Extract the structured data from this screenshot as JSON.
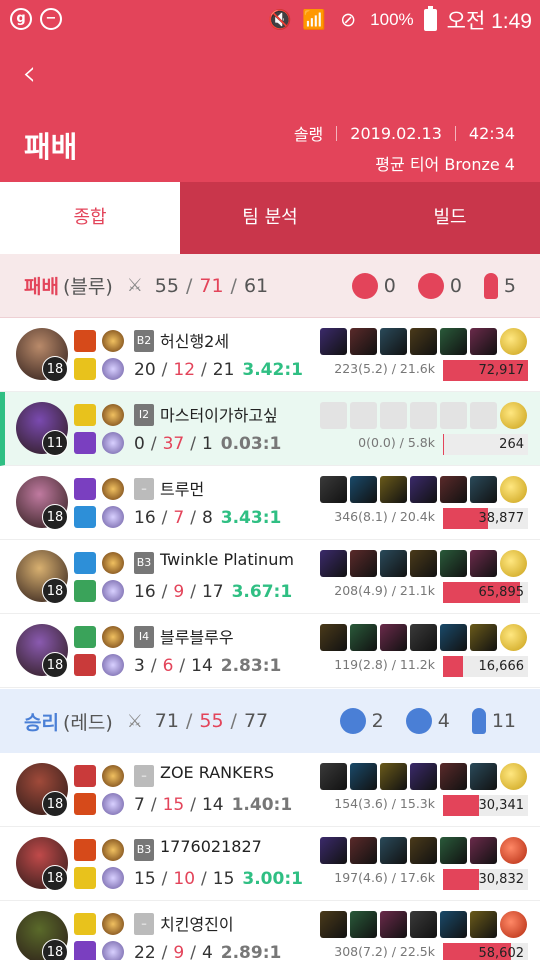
{
  "status_bar": {
    "left_icons": [
      "g",
      "−"
    ],
    "battery": "100%",
    "time": "오전 1:49"
  },
  "header": {
    "title": "패배",
    "queue": "솔랭",
    "date": "2019.02.13",
    "duration": "42:34",
    "avg_tier": "평균 티어 Bronze 4"
  },
  "tabs": [
    "종합",
    "팀 분석",
    "빌드"
  ],
  "teams": [
    {
      "result": "패배",
      "side": "(블루)",
      "kills": "55",
      "deaths": "71",
      "assists": "61",
      "towers": "0",
      "dragons": "0",
      "barons": "5",
      "players": [
        {
          "level": "18",
          "tier": "B2",
          "name": "허신행2세",
          "k": "20",
          "d": "12",
          "a": "21",
          "ratio": "3.42:1",
          "cs": "223(5.2) / 21.6k",
          "damage": "72,917",
          "damage_pct": 1.0
        },
        {
          "level": "11",
          "tier": "I2",
          "name": "마스터이가하고싶",
          "k": "0",
          "d": "37",
          "a": "1",
          "ratio": "0.03:1",
          "cs": "0(0.0) / 5.8k",
          "damage": "264",
          "damage_pct": 0.004
        },
        {
          "level": "18",
          "tier": "–",
          "name": "트루먼",
          "k": "16",
          "d": "7",
          "a": "8",
          "ratio": "3.43:1",
          "cs": "346(8.1) / 20.4k",
          "damage": "38,877",
          "damage_pct": 0.53
        },
        {
          "level": "18",
          "tier": "B3",
          "name": "Twinkle Platinum",
          "k": "16",
          "d": "9",
          "a": "17",
          "ratio": "3.67:1",
          "cs": "208(4.9) / 21.1k",
          "damage": "65,895",
          "damage_pct": 0.9
        },
        {
          "level": "18",
          "tier": "I4",
          "name": "블루블루우",
          "k": "3",
          "d": "6",
          "a": "14",
          "ratio": "2.83:1",
          "cs": "119(2.8) / 11.2k",
          "damage": "16,666",
          "damage_pct": 0.23
        }
      ]
    },
    {
      "result": "승리",
      "side": "(레드)",
      "kills": "71",
      "deaths": "55",
      "assists": "77",
      "towers": "2",
      "dragons": "4",
      "barons": "11",
      "players": [
        {
          "level": "18",
          "tier": "–",
          "name": "ZOE RANKERS",
          "k": "7",
          "d": "15",
          "a": "14",
          "ratio": "1.40:1",
          "cs": "154(3.6) / 15.3k",
          "damage": "30,341",
          "damage_pct": 0.42
        },
        {
          "level": "18",
          "tier": "B3",
          "name": "1776021827",
          "k": "15",
          "d": "10",
          "a": "15",
          "ratio": "3.00:1",
          "cs": "197(4.6) / 17.6k",
          "damage": "30,832",
          "damage_pct": 0.42
        },
        {
          "level": "18",
          "tier": "–",
          "name": "치킨영진이",
          "k": "22",
          "d": "9",
          "a": "4",
          "ratio": "2.89:1",
          "cs": "308(7.2) / 22.5k",
          "damage": "58,602",
          "damage_pct": 0.8
        }
      ]
    }
  ],
  "colors": {
    "header": "#e3445a",
    "tab_inactive": "#c9364b",
    "lose": "#e3445a",
    "win": "#4a7fd6",
    "good_ratio": "#2fbf83",
    "highlight_row": "#eaf8f1"
  }
}
